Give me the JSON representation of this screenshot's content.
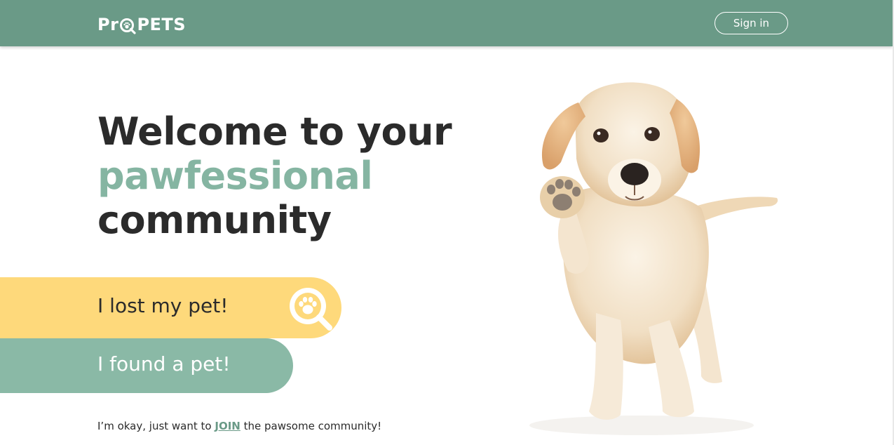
{
  "header": {
    "logo_text_left": "Pr",
    "logo_text_right": "PETS",
    "signin_label": "Sign in"
  },
  "hero": {
    "line1": "Welcome to your",
    "line2": "pawfessional",
    "line3": "community"
  },
  "actions": {
    "lost_label": "I lost my pet!",
    "found_label": "I found a pet!"
  },
  "join": {
    "prefix": "I’m okay, just want to",
    "link": "JOIN",
    "suffix": "the pawsome community!"
  },
  "colors": {
    "header_bg": "#6a9a87",
    "accent_text": "#85b5a2",
    "lost_bg": "#fed97b",
    "found_bg": "#8ab9a6"
  },
  "icons": {
    "logo_o": "magnifier-paw-icon",
    "lost_icon": "magnifier-paw-icon",
    "hero_image": "puppy-image"
  }
}
